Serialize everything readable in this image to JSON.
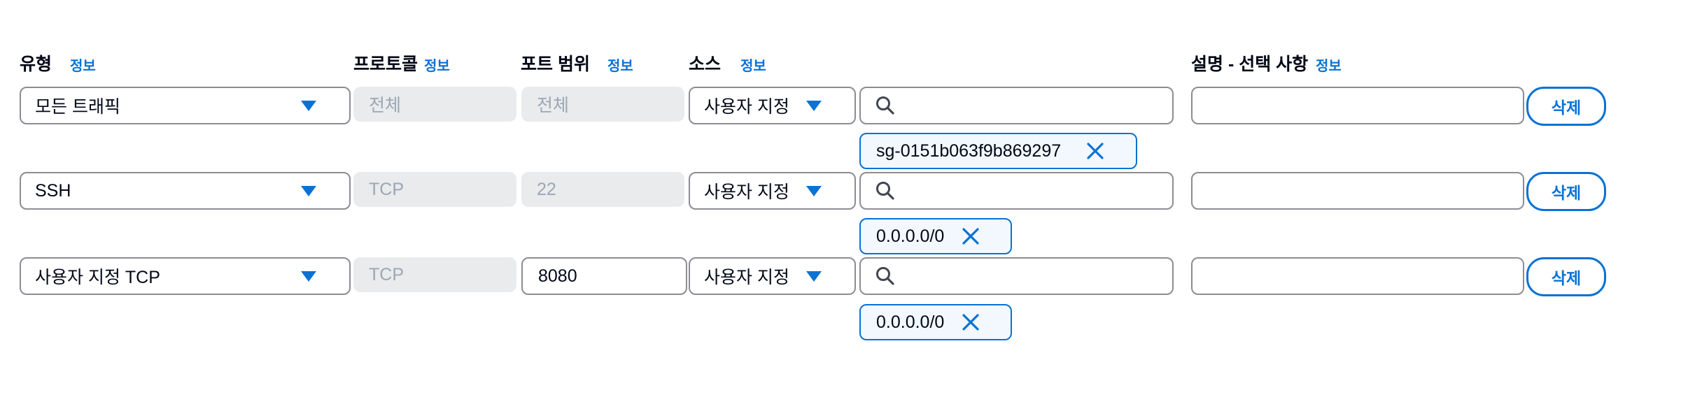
{
  "headers": {
    "type": "유형",
    "protocol": "프로토콜",
    "port_range": "포트 범위",
    "source": "소스",
    "description": "설명 - 선택 사항",
    "info": "정보"
  },
  "rows": [
    {
      "type": "모든 트래픽",
      "protocol": "전체",
      "port_range": "전체",
      "port_editable": false,
      "source_type": "사용자 지정",
      "search_value": "",
      "token": "sg-0151b063f9b869297",
      "description": "",
      "delete_label": "삭제"
    },
    {
      "type": "SSH",
      "protocol": "TCP",
      "port_range": "22",
      "port_editable": false,
      "source_type": "사용자 지정",
      "search_value": "",
      "token": "0.0.0.0/0",
      "description": "",
      "delete_label": "삭제"
    },
    {
      "type": "사용자 지정 TCP",
      "protocol": "TCP",
      "port_range": "8080",
      "port_editable": true,
      "source_type": "사용자 지정",
      "search_value": "",
      "token": "0.0.0.0/0",
      "description": "",
      "delete_label": "삭제"
    }
  ],
  "colors": {
    "accent": "#0972d3",
    "disabled_bg": "#e9ebed",
    "disabled_text": "#9ba7b6",
    "border": "#8c8c94"
  },
  "icons": {
    "caret": "caret-down-icon",
    "search": "search-icon",
    "remove": "close-icon"
  }
}
